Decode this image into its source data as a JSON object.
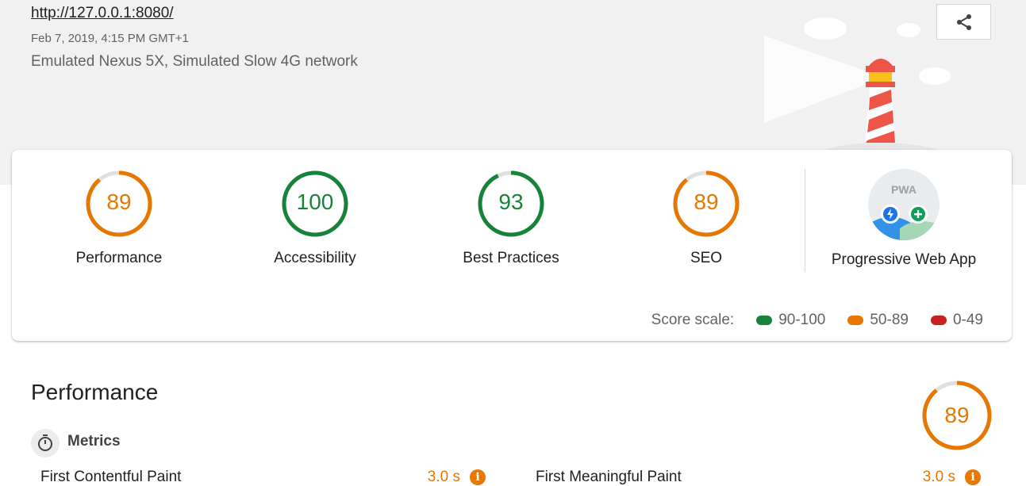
{
  "header": {
    "url": "http://127.0.0.1:8080/",
    "date": "Feb 7, 2019, 4:15 PM GMT+1",
    "environment": "Emulated Nexus 5X, Simulated Slow 4G network",
    "share_icon": "share-icon"
  },
  "categories": [
    {
      "label": "Performance",
      "score": "89",
      "fraction": 0.89,
      "color": "#e67700"
    },
    {
      "label": "Accessibility",
      "score": "100",
      "fraction": 1.0,
      "color": "#178239"
    },
    {
      "label": "Best Practices",
      "score": "93",
      "fraction": 0.93,
      "color": "#178239"
    },
    {
      "label": "SEO",
      "score": "89",
      "fraction": 0.89,
      "color": "#e67700"
    },
    {
      "label": "Progressive Web App",
      "badge_text": "PWA"
    }
  ],
  "scale": {
    "label": "Score scale:",
    "ranges": [
      {
        "label": "90-100",
        "color": "#178239"
      },
      {
        "label": "50-89",
        "color": "#e67700"
      },
      {
        "label": "0-49",
        "color": "#c7221f"
      }
    ]
  },
  "performance_section": {
    "title": "Performance",
    "score": "89",
    "fraction": 0.89,
    "metrics_label": "Metrics",
    "metrics_icon": "stopwatch-icon",
    "metrics": [
      {
        "name": "First Contentful Paint",
        "value": "3.0 s"
      },
      {
        "name": "First Meaningful Paint",
        "value": "3.0 s"
      }
    ]
  }
}
